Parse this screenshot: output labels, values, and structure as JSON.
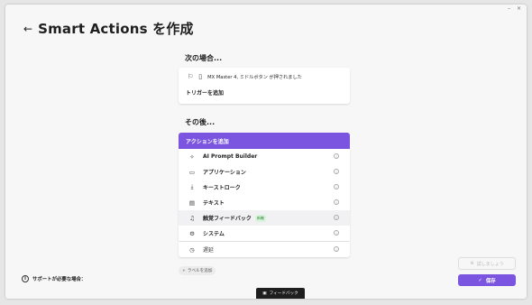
{
  "window": {
    "minimize": "–",
    "close": "×"
  },
  "header": {
    "title": "Smart Actions を作成",
    "back": "←"
  },
  "when_section": {
    "heading": "次の場合...",
    "trigger_text": "MX Master 4, ミドルボタン が押されました",
    "add_trigger_label": "トリガーを追加"
  },
  "then_section": {
    "heading": "その後...",
    "add_action_label": "アクションを追加",
    "items": [
      {
        "label": "AI Prompt Builder",
        "icon": "sparkle-icon",
        "glyph": "✧",
        "badge": ""
      },
      {
        "label": "アプリケーション",
        "icon": "app-window-icon",
        "glyph": "▭",
        "badge": ""
      },
      {
        "label": "キーストローク",
        "icon": "download-icon",
        "glyph": "⤓",
        "badge": ""
      },
      {
        "label": "テキスト",
        "icon": "document-icon",
        "glyph": "▤",
        "badge": ""
      },
      {
        "label": "触覚フィードバック",
        "icon": "bell-icon",
        "glyph": "♫",
        "badge": "新機"
      },
      {
        "label": "システム",
        "icon": "gear-icon",
        "glyph": "⚙",
        "badge": ""
      }
    ],
    "delay": {
      "label": "遅延",
      "icon": "clock-icon",
      "glyph": "◷"
    }
  },
  "add_label": "ラベルを追加",
  "support_text": "サポートが必要な場合：",
  "try_button": "試しましょう",
  "save_button": "保存",
  "feedback_button": "フィードバック",
  "colors": {
    "accent": "#7b55e0",
    "background": "#f7f7f7"
  }
}
